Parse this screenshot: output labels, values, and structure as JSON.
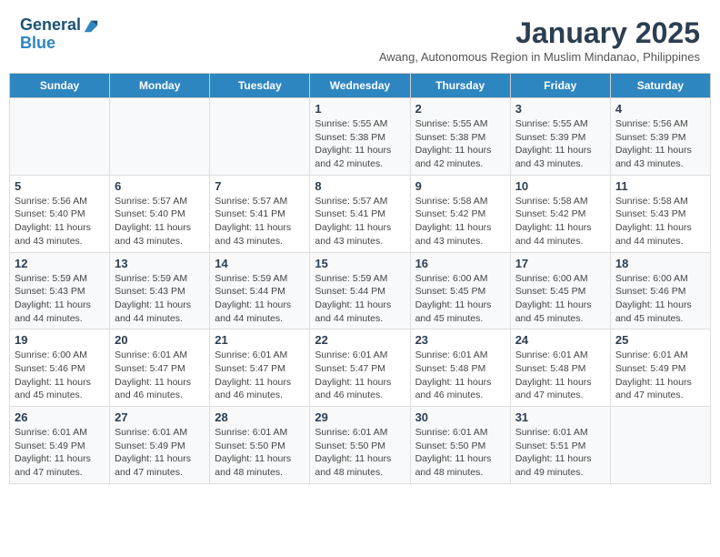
{
  "logo": {
    "line1": "General",
    "line2": "Blue"
  },
  "title": "January 2025",
  "subtitle": "Awang, Autonomous Region in Muslim Mindanao, Philippines",
  "days_header": [
    "Sunday",
    "Monday",
    "Tuesday",
    "Wednesday",
    "Thursday",
    "Friday",
    "Saturday"
  ],
  "weeks": [
    [
      {
        "day": "",
        "info": ""
      },
      {
        "day": "",
        "info": ""
      },
      {
        "day": "",
        "info": ""
      },
      {
        "day": "1",
        "info": "Sunrise: 5:55 AM\nSunset: 5:38 PM\nDaylight: 11 hours\nand 42 minutes."
      },
      {
        "day": "2",
        "info": "Sunrise: 5:55 AM\nSunset: 5:38 PM\nDaylight: 11 hours\nand 42 minutes."
      },
      {
        "day": "3",
        "info": "Sunrise: 5:55 AM\nSunset: 5:39 PM\nDaylight: 11 hours\nand 43 minutes."
      },
      {
        "day": "4",
        "info": "Sunrise: 5:56 AM\nSunset: 5:39 PM\nDaylight: 11 hours\nand 43 minutes."
      }
    ],
    [
      {
        "day": "5",
        "info": "Sunrise: 5:56 AM\nSunset: 5:40 PM\nDaylight: 11 hours\nand 43 minutes."
      },
      {
        "day": "6",
        "info": "Sunrise: 5:57 AM\nSunset: 5:40 PM\nDaylight: 11 hours\nand 43 minutes."
      },
      {
        "day": "7",
        "info": "Sunrise: 5:57 AM\nSunset: 5:41 PM\nDaylight: 11 hours\nand 43 minutes."
      },
      {
        "day": "8",
        "info": "Sunrise: 5:57 AM\nSunset: 5:41 PM\nDaylight: 11 hours\nand 43 minutes."
      },
      {
        "day": "9",
        "info": "Sunrise: 5:58 AM\nSunset: 5:42 PM\nDaylight: 11 hours\nand 43 minutes."
      },
      {
        "day": "10",
        "info": "Sunrise: 5:58 AM\nSunset: 5:42 PM\nDaylight: 11 hours\nand 44 minutes."
      },
      {
        "day": "11",
        "info": "Sunrise: 5:58 AM\nSunset: 5:43 PM\nDaylight: 11 hours\nand 44 minutes."
      }
    ],
    [
      {
        "day": "12",
        "info": "Sunrise: 5:59 AM\nSunset: 5:43 PM\nDaylight: 11 hours\nand 44 minutes."
      },
      {
        "day": "13",
        "info": "Sunrise: 5:59 AM\nSunset: 5:43 PM\nDaylight: 11 hours\nand 44 minutes."
      },
      {
        "day": "14",
        "info": "Sunrise: 5:59 AM\nSunset: 5:44 PM\nDaylight: 11 hours\nand 44 minutes."
      },
      {
        "day": "15",
        "info": "Sunrise: 5:59 AM\nSunset: 5:44 PM\nDaylight: 11 hours\nand 44 minutes."
      },
      {
        "day": "16",
        "info": "Sunrise: 6:00 AM\nSunset: 5:45 PM\nDaylight: 11 hours\nand 45 minutes."
      },
      {
        "day": "17",
        "info": "Sunrise: 6:00 AM\nSunset: 5:45 PM\nDaylight: 11 hours\nand 45 minutes."
      },
      {
        "day": "18",
        "info": "Sunrise: 6:00 AM\nSunset: 5:46 PM\nDaylight: 11 hours\nand 45 minutes."
      }
    ],
    [
      {
        "day": "19",
        "info": "Sunrise: 6:00 AM\nSunset: 5:46 PM\nDaylight: 11 hours\nand 45 minutes."
      },
      {
        "day": "20",
        "info": "Sunrise: 6:01 AM\nSunset: 5:47 PM\nDaylight: 11 hours\nand 46 minutes."
      },
      {
        "day": "21",
        "info": "Sunrise: 6:01 AM\nSunset: 5:47 PM\nDaylight: 11 hours\nand 46 minutes."
      },
      {
        "day": "22",
        "info": "Sunrise: 6:01 AM\nSunset: 5:47 PM\nDaylight: 11 hours\nand 46 minutes."
      },
      {
        "day": "23",
        "info": "Sunrise: 6:01 AM\nSunset: 5:48 PM\nDaylight: 11 hours\nand 46 minutes."
      },
      {
        "day": "24",
        "info": "Sunrise: 6:01 AM\nSunset: 5:48 PM\nDaylight: 11 hours\nand 47 minutes."
      },
      {
        "day": "25",
        "info": "Sunrise: 6:01 AM\nSunset: 5:49 PM\nDaylight: 11 hours\nand 47 minutes."
      }
    ],
    [
      {
        "day": "26",
        "info": "Sunrise: 6:01 AM\nSunset: 5:49 PM\nDaylight: 11 hours\nand 47 minutes."
      },
      {
        "day": "27",
        "info": "Sunrise: 6:01 AM\nSunset: 5:49 PM\nDaylight: 11 hours\nand 47 minutes."
      },
      {
        "day": "28",
        "info": "Sunrise: 6:01 AM\nSunset: 5:50 PM\nDaylight: 11 hours\nand 48 minutes."
      },
      {
        "day": "29",
        "info": "Sunrise: 6:01 AM\nSunset: 5:50 PM\nDaylight: 11 hours\nand 48 minutes."
      },
      {
        "day": "30",
        "info": "Sunrise: 6:01 AM\nSunset: 5:50 PM\nDaylight: 11 hours\nand 48 minutes."
      },
      {
        "day": "31",
        "info": "Sunrise: 6:01 AM\nSunset: 5:51 PM\nDaylight: 11 hours\nand 49 minutes."
      },
      {
        "day": "",
        "info": ""
      }
    ]
  ]
}
